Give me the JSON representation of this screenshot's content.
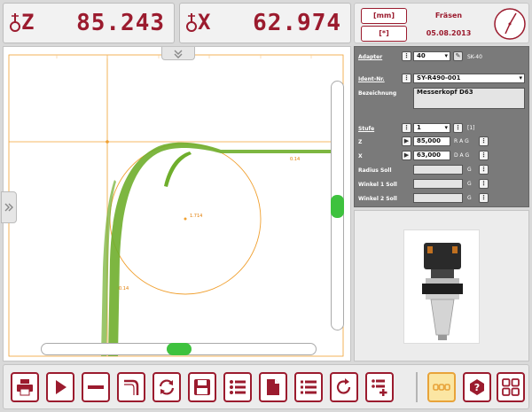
{
  "dro": {
    "z": {
      "axis": "Z",
      "value": "85.243"
    },
    "x": {
      "axis": "X",
      "value": "62.974"
    }
  },
  "header": {
    "unit_button": "[mm]",
    "mode": "Fräsen",
    "bracket_button": "[*]",
    "date": "05.08.2013"
  },
  "viewport": {
    "labels": {
      "small_top": "0.14",
      "center": "1.714",
      "bottom": "0.14"
    }
  },
  "tool": {
    "adapter_label": "Adapter",
    "adapter_value": "40",
    "adapter_extra": "SK-40",
    "ident_label": "Ident-Nr.",
    "ident_value": "SY-R490-001",
    "bezeichnung_label": "Bezeichnung",
    "bezeichnung_value": "Messerkopf D63",
    "stufe_label": "Stufe",
    "stufe_value": "1",
    "stufe_unit": "[1]",
    "z_label": "Z",
    "z_value": "85,000",
    "z_unit": "R A G",
    "x_label": "X",
    "x_value": "63,000",
    "x_unit": "D A G",
    "radius_label": "Radius Soll",
    "radius_unit": "G",
    "winkel1_label": "Winkel 1 Soll",
    "winkel1_unit": "G",
    "winkel2_label": "Winkel 2 Soll",
    "winkel2_unit": "G"
  },
  "toolbar": {
    "buttons": [
      "print-icon",
      "play-icon",
      "line-icon",
      "profile-icon",
      "swap-icon",
      "save-icon",
      "list-icon",
      "document-icon",
      "list-alt-icon",
      "refresh-icon",
      "list-add-icon",
      "chain-icon",
      "help-icon",
      "grid-icon"
    ]
  },
  "colors": {
    "accent": "#9b1b2e",
    "profile": "#6fae2c",
    "construction": "#f0a030",
    "slider": "#3ec23e"
  }
}
